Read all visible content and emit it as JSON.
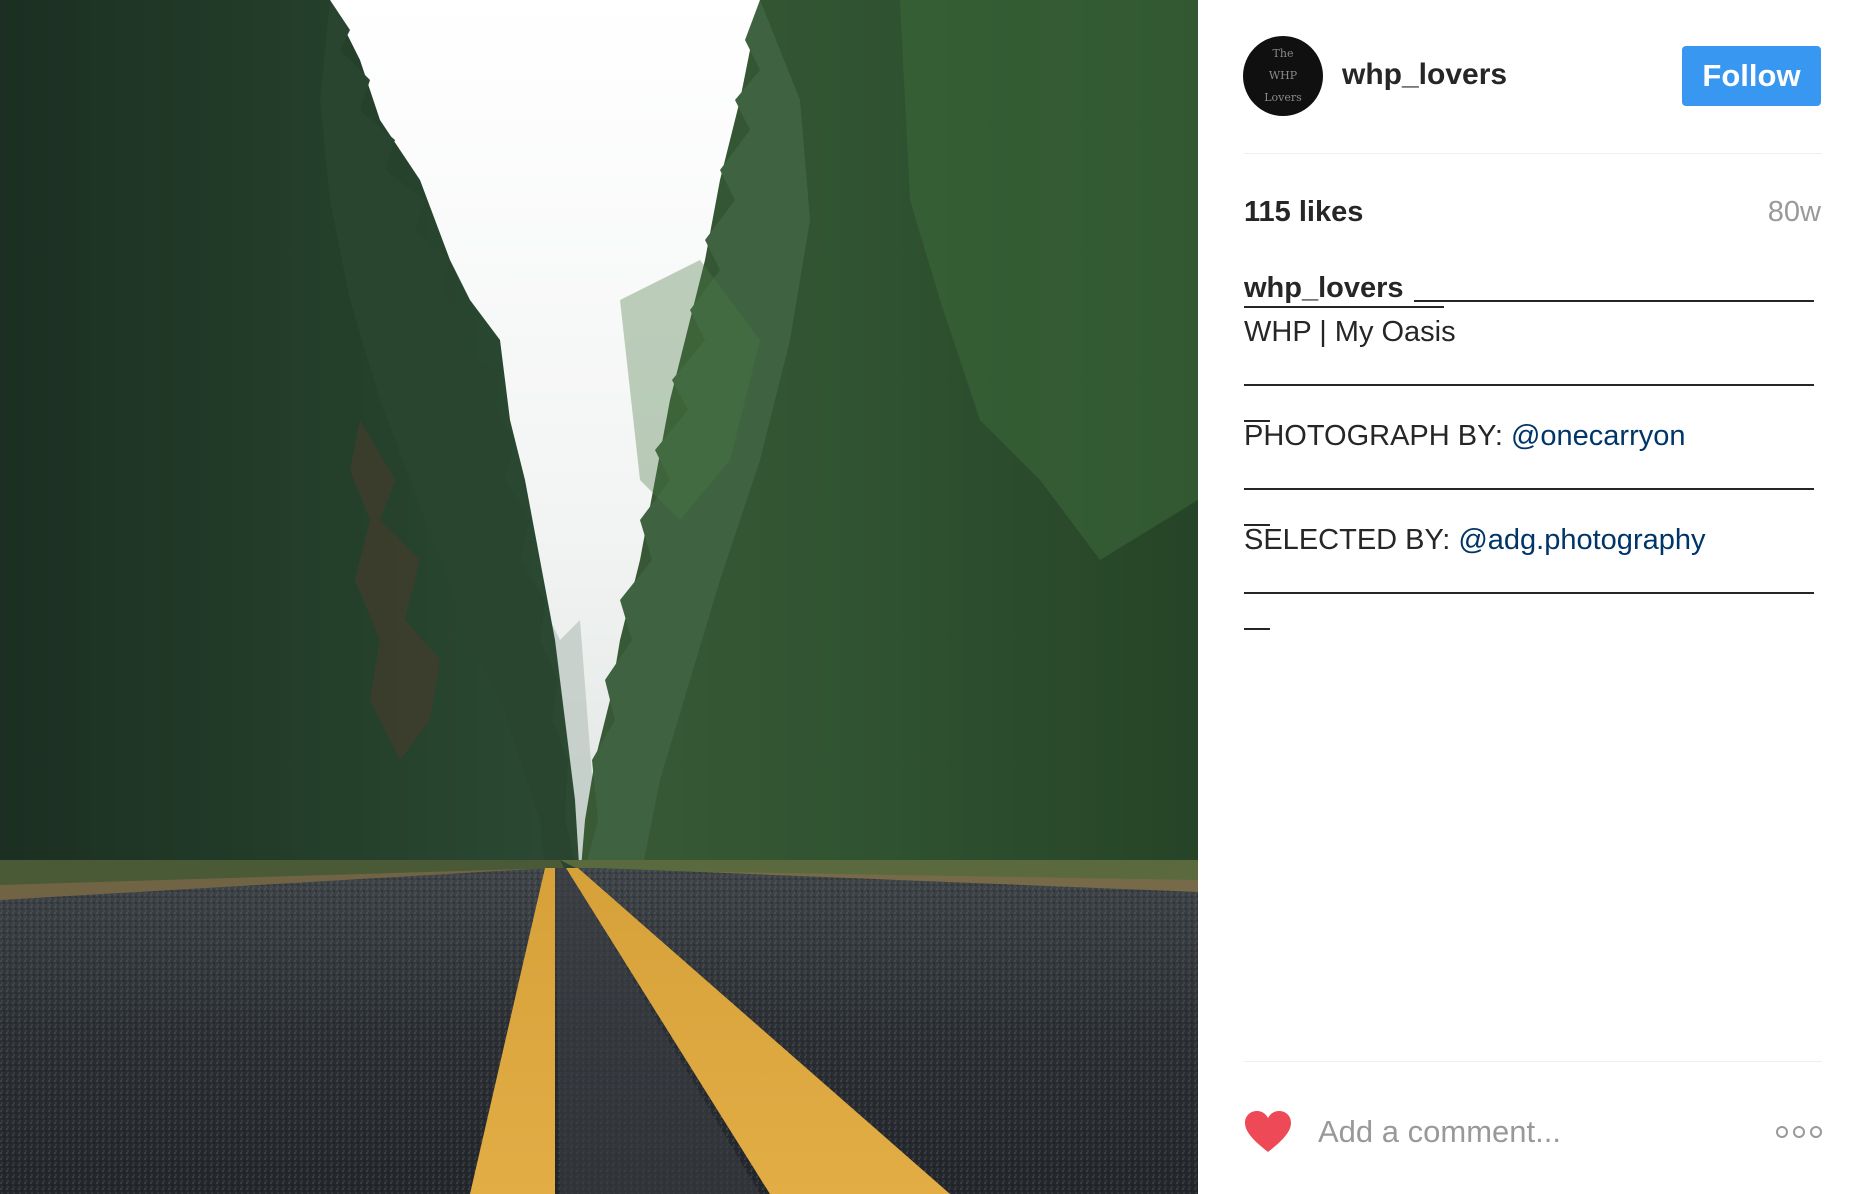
{
  "post": {
    "username": "whp_lovers",
    "avatar_text": [
      "The",
      "WHP",
      "Lovers"
    ],
    "follow_label": "Follow",
    "likes": "115 likes",
    "time_ago": "80w",
    "caption": {
      "username": "whp_lovers",
      "title": "WHP | My Oasis",
      "photographer_label": "PHOTOGRAPH BY:",
      "photographer_handle": "@onecarryon",
      "selector_label": "SELECTED BY:",
      "selector_handle": "@adg.photography"
    },
    "comment_placeholder": "Add a comment..."
  },
  "colors": {
    "follow_blue": "#3897f0",
    "heart_red": "#ed4956",
    "mention_blue": "#003569",
    "text_dark": "#262626",
    "text_muted": "#999999"
  },
  "icons": {
    "heart": "heart-icon",
    "more": "more-options-icon"
  }
}
